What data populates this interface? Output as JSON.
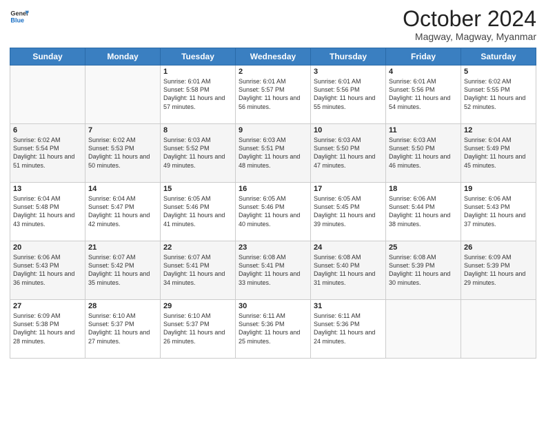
{
  "logo": {
    "line1": "General",
    "line2": "Blue"
  },
  "header": {
    "month": "October 2024",
    "location": "Magway, Magway, Myanmar"
  },
  "weekdays": [
    "Sunday",
    "Monday",
    "Tuesday",
    "Wednesday",
    "Thursday",
    "Friday",
    "Saturday"
  ],
  "weeks": [
    [
      {
        "day": "",
        "content": ""
      },
      {
        "day": "",
        "content": ""
      },
      {
        "day": "1",
        "content": "Sunrise: 6:01 AM\nSunset: 5:58 PM\nDaylight: 11 hours and 57 minutes."
      },
      {
        "day": "2",
        "content": "Sunrise: 6:01 AM\nSunset: 5:57 PM\nDaylight: 11 hours and 56 minutes."
      },
      {
        "day": "3",
        "content": "Sunrise: 6:01 AM\nSunset: 5:56 PM\nDaylight: 11 hours and 55 minutes."
      },
      {
        "day": "4",
        "content": "Sunrise: 6:01 AM\nSunset: 5:56 PM\nDaylight: 11 hours and 54 minutes."
      },
      {
        "day": "5",
        "content": "Sunrise: 6:02 AM\nSunset: 5:55 PM\nDaylight: 11 hours and 52 minutes."
      }
    ],
    [
      {
        "day": "6",
        "content": "Sunrise: 6:02 AM\nSunset: 5:54 PM\nDaylight: 11 hours and 51 minutes."
      },
      {
        "day": "7",
        "content": "Sunrise: 6:02 AM\nSunset: 5:53 PM\nDaylight: 11 hours and 50 minutes."
      },
      {
        "day": "8",
        "content": "Sunrise: 6:03 AM\nSunset: 5:52 PM\nDaylight: 11 hours and 49 minutes."
      },
      {
        "day": "9",
        "content": "Sunrise: 6:03 AM\nSunset: 5:51 PM\nDaylight: 11 hours and 48 minutes."
      },
      {
        "day": "10",
        "content": "Sunrise: 6:03 AM\nSunset: 5:50 PM\nDaylight: 11 hours and 47 minutes."
      },
      {
        "day": "11",
        "content": "Sunrise: 6:03 AM\nSunset: 5:50 PM\nDaylight: 11 hours and 46 minutes."
      },
      {
        "day": "12",
        "content": "Sunrise: 6:04 AM\nSunset: 5:49 PM\nDaylight: 11 hours and 45 minutes."
      }
    ],
    [
      {
        "day": "13",
        "content": "Sunrise: 6:04 AM\nSunset: 5:48 PM\nDaylight: 11 hours and 43 minutes."
      },
      {
        "day": "14",
        "content": "Sunrise: 6:04 AM\nSunset: 5:47 PM\nDaylight: 11 hours and 42 minutes."
      },
      {
        "day": "15",
        "content": "Sunrise: 6:05 AM\nSunset: 5:46 PM\nDaylight: 11 hours and 41 minutes."
      },
      {
        "day": "16",
        "content": "Sunrise: 6:05 AM\nSunset: 5:46 PM\nDaylight: 11 hours and 40 minutes."
      },
      {
        "day": "17",
        "content": "Sunrise: 6:05 AM\nSunset: 5:45 PM\nDaylight: 11 hours and 39 minutes."
      },
      {
        "day": "18",
        "content": "Sunrise: 6:06 AM\nSunset: 5:44 PM\nDaylight: 11 hours and 38 minutes."
      },
      {
        "day": "19",
        "content": "Sunrise: 6:06 AM\nSunset: 5:43 PM\nDaylight: 11 hours and 37 minutes."
      }
    ],
    [
      {
        "day": "20",
        "content": "Sunrise: 6:06 AM\nSunset: 5:43 PM\nDaylight: 11 hours and 36 minutes."
      },
      {
        "day": "21",
        "content": "Sunrise: 6:07 AM\nSunset: 5:42 PM\nDaylight: 11 hours and 35 minutes."
      },
      {
        "day": "22",
        "content": "Sunrise: 6:07 AM\nSunset: 5:41 PM\nDaylight: 11 hours and 34 minutes."
      },
      {
        "day": "23",
        "content": "Sunrise: 6:08 AM\nSunset: 5:41 PM\nDaylight: 11 hours and 33 minutes."
      },
      {
        "day": "24",
        "content": "Sunrise: 6:08 AM\nSunset: 5:40 PM\nDaylight: 11 hours and 31 minutes."
      },
      {
        "day": "25",
        "content": "Sunrise: 6:08 AM\nSunset: 5:39 PM\nDaylight: 11 hours and 30 minutes."
      },
      {
        "day": "26",
        "content": "Sunrise: 6:09 AM\nSunset: 5:39 PM\nDaylight: 11 hours and 29 minutes."
      }
    ],
    [
      {
        "day": "27",
        "content": "Sunrise: 6:09 AM\nSunset: 5:38 PM\nDaylight: 11 hours and 28 minutes."
      },
      {
        "day": "28",
        "content": "Sunrise: 6:10 AM\nSunset: 5:37 PM\nDaylight: 11 hours and 27 minutes."
      },
      {
        "day": "29",
        "content": "Sunrise: 6:10 AM\nSunset: 5:37 PM\nDaylight: 11 hours and 26 minutes."
      },
      {
        "day": "30",
        "content": "Sunrise: 6:11 AM\nSunset: 5:36 PM\nDaylight: 11 hours and 25 minutes."
      },
      {
        "day": "31",
        "content": "Sunrise: 6:11 AM\nSunset: 5:36 PM\nDaylight: 11 hours and 24 minutes."
      },
      {
        "day": "",
        "content": ""
      },
      {
        "day": "",
        "content": ""
      }
    ]
  ]
}
